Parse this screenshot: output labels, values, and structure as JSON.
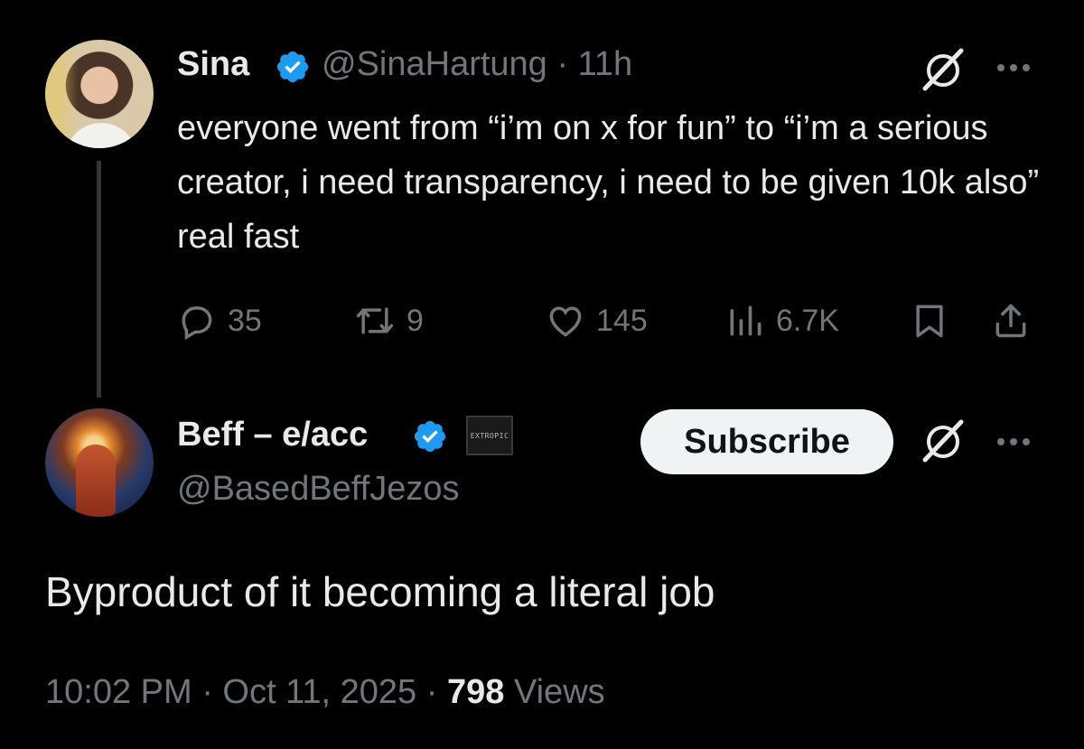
{
  "parent_tweet": {
    "display_name": "Sina",
    "handle": "@SinaHartung",
    "time_ago": "11h",
    "text": "everyone went from “i’m on x for fun” to “i’m a serious creator, i need transparency, i need to be given 10k also” real fast",
    "actions": {
      "replies": "35",
      "reposts": "9",
      "likes": "145",
      "views": "6.7K"
    }
  },
  "reply_tweet": {
    "display_name": "Beff – e/acc",
    "handle": "@BasedBeffJezos",
    "affiliate_badge": "EXTROPIC",
    "subscribe_label": "Subscribe",
    "text": "Byproduct of it becoming a literal job",
    "timestamp": "10:02 PM · Oct 11, 2025",
    "views_count": "798",
    "views_label": "Views"
  },
  "colors": {
    "background": "#000000",
    "primary_text": "#e7e9ea",
    "secondary_text": "#71767b",
    "verified_blue": "#1d9bf0",
    "subscribe_bg": "#eff3f4"
  },
  "icons": {
    "reply": "reply-icon",
    "repost": "repost-icon",
    "like": "heart-icon",
    "views": "views-icon",
    "bookmark": "bookmark-icon",
    "share": "share-icon",
    "grok": "grok-icon",
    "more": "more-icon",
    "verified": "verified-badge-icon"
  }
}
